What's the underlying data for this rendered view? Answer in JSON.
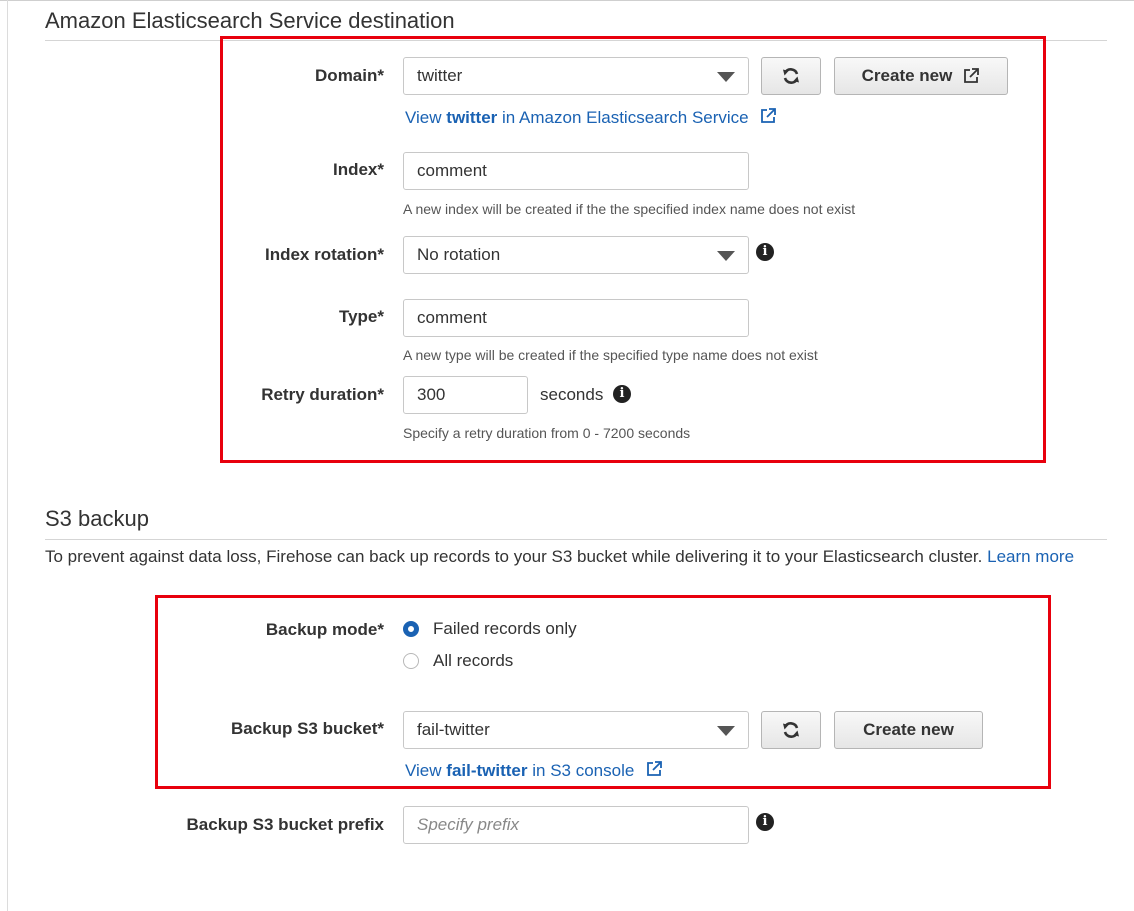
{
  "es": {
    "title": "Amazon Elasticsearch Service destination",
    "domain": {
      "label": "Domain*",
      "value": "twitter",
      "create_label": "Create new",
      "view_prefix": "View",
      "view_bold": "twitter",
      "view_suffix": "in Amazon Elasticsearch Service"
    },
    "index": {
      "label": "Index*",
      "value": "comment",
      "hint": "A new index will be created if the the specified index name does not exist"
    },
    "rotation": {
      "label": "Index rotation*",
      "value": "No rotation"
    },
    "type": {
      "label": "Type*",
      "value": "comment",
      "hint": "A new type will be created if the specified type name does not exist"
    },
    "retry": {
      "label": "Retry duration*",
      "value": "300",
      "units": "seconds",
      "hint": "Specify a retry duration from 0 - 7200 seconds"
    }
  },
  "s3": {
    "title": "S3 backup",
    "description": "To prevent against data loss, Firehose can back up records to your S3 bucket while delivering it to your Elasticsearch cluster.",
    "learn_more": "Learn more",
    "mode": {
      "label": "Backup mode*",
      "options": [
        "Failed records only",
        "All records"
      ],
      "selected": "Failed records only"
    },
    "bucket": {
      "label": "Backup S3 bucket*",
      "value": "fail-twitter",
      "create_label": "Create new",
      "view_prefix": "View",
      "view_bold": "fail-twitter",
      "view_suffix": "in S3 console"
    },
    "prefix": {
      "label": "Backup S3 bucket prefix",
      "placeholder": "Specify prefix"
    }
  },
  "colors": {
    "highlight": "#e8000d",
    "link": "#1a62b3"
  },
  "icons": [
    "refresh-icon",
    "external-link-icon",
    "info-icon",
    "chevron-down-icon"
  ]
}
